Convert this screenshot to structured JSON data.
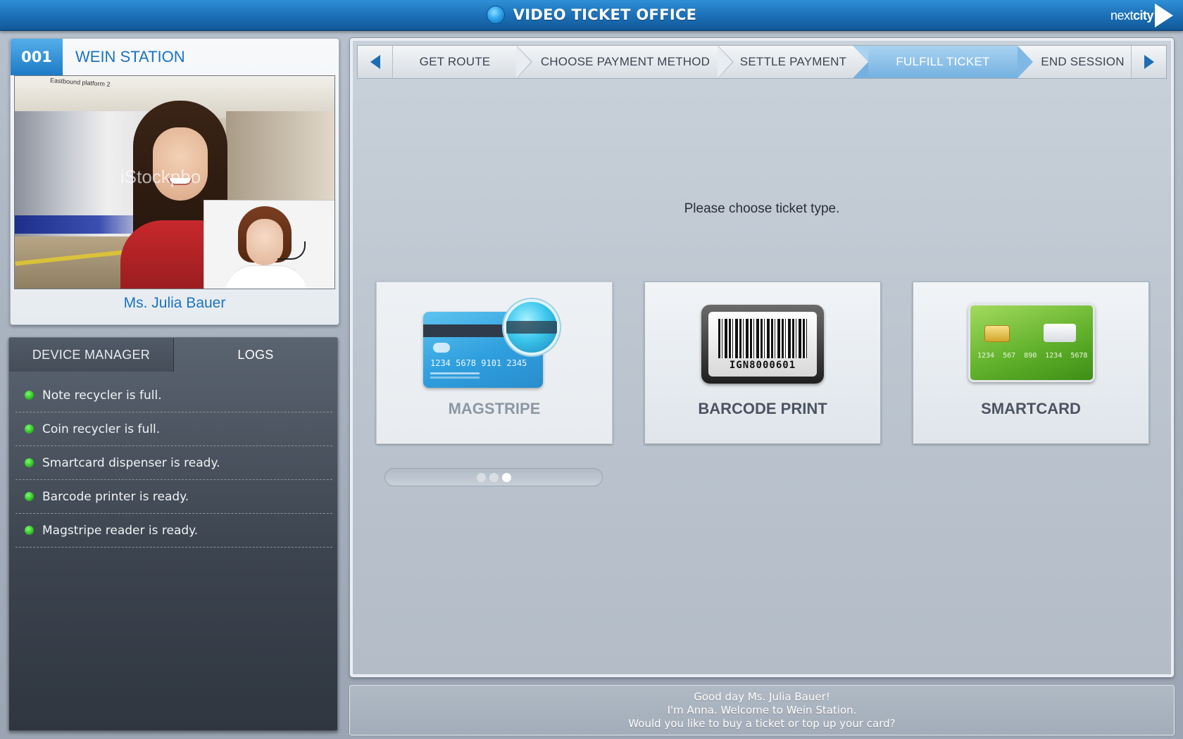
{
  "header": {
    "title": "VIDEO TICKET OFFICE",
    "logo_prefix": "next",
    "logo_bold": "city"
  },
  "station": {
    "number": "001",
    "name": "WEIN STATION",
    "video_watermark": "iStockpho",
    "video_sign": "Eastbound platform 2",
    "agent_name": "Ms. Julia Bauer"
  },
  "device_panel": {
    "tabs": [
      {
        "label": "DEVICE MANAGER"
      },
      {
        "label": "LOGS"
      }
    ],
    "logs": [
      {
        "text": "Note recycler is full.",
        "status": "ok"
      },
      {
        "text": "Coin recycler is full.",
        "status": "ok"
      },
      {
        "text": "Smartcard dispenser is ready.",
        "status": "ok"
      },
      {
        "text": "Barcode printer is ready.",
        "status": "ok"
      },
      {
        "text": "Magstripe reader is ready.",
        "status": "ok"
      }
    ]
  },
  "steps": [
    {
      "label": "GET ROUTE"
    },
    {
      "label": "CHOOSE PAYMENT METHOD"
    },
    {
      "label": "SETTLE PAYMENT"
    },
    {
      "label": "FULFILL TICKET",
      "active": true
    },
    {
      "label": "END SESSION"
    }
  ],
  "main": {
    "prompt": "Please choose ticket type.",
    "options": [
      {
        "label": "MAGSTRIPE",
        "card_number": "1234 5678 9101 2345",
        "selected": true
      },
      {
        "label": "BARCODE PRINT",
        "code": "IGN8000601"
      },
      {
        "label": "SMARTCARD",
        "card_number": "1234 567 890 1234 5678"
      }
    ],
    "pager": {
      "count": 3,
      "current": 3
    }
  },
  "message": {
    "lines": [
      "Good day Ms. Julia Bauer!",
      "I'm Anna. Welcome to Wein Station.",
      "Would you like to buy a ticket or top up your card?"
    ]
  },
  "colors": {
    "accent": "#1b73c0",
    "header_blue": "#1b6fb6",
    "active_step": "#74b1e0",
    "status_ok": "#2fbf24"
  }
}
